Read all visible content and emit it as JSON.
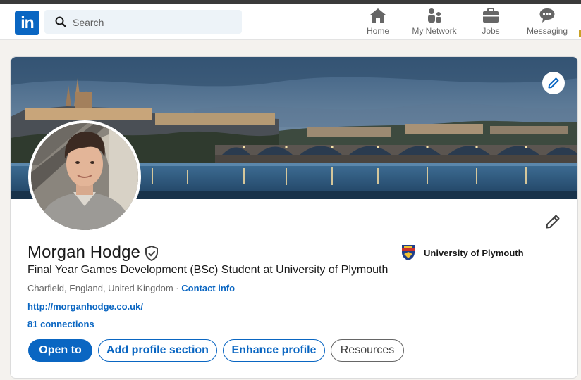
{
  "nav": {
    "logo_text": "in",
    "search_placeholder": "Search",
    "items": [
      {
        "label": "Home",
        "icon": "home-icon"
      },
      {
        "label": "My Network",
        "icon": "network-icon"
      },
      {
        "label": "Jobs",
        "icon": "briefcase-icon"
      },
      {
        "label": "Messaging",
        "icon": "messaging-icon"
      }
    ]
  },
  "profile": {
    "name": "Morgan Hodge",
    "headline": "Final Year Games Development (BSc) Student at University of Plymouth",
    "location": "Charfield, England, United Kingdom",
    "separator": " · ",
    "contact_info": "Contact info",
    "website": "http://morganhodge.co.uk/",
    "connections": "81 connections",
    "school": "University of Plymouth"
  },
  "actions": {
    "open_to": "Open to",
    "add_section": "Add profile section",
    "enhance": "Enhance profile",
    "resources": "Resources"
  },
  "colors": {
    "brand": "#0a66c2",
    "background": "#f4f2ee"
  }
}
